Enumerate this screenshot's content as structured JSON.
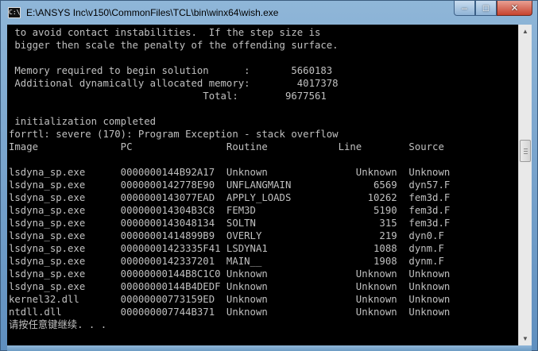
{
  "window": {
    "title": "E:\\ANSYS Inc\\v150\\CommonFiles\\TCL\\bin\\winx64\\wish.exe",
    "icon_text": "C:\\",
    "buttons": {
      "minimize": "–",
      "maximize": "□",
      "close": "✕"
    }
  },
  "console": {
    "lines": [
      " to avoid contact instabilities.  If the step size is",
      " bigger then scale the penalty of the offending surface.",
      "",
      " Memory required to begin solution      :       5660183",
      " Additional dynamically allocated memory:        4017378",
      "                                 Total:        9677561",
      "",
      " initialization completed",
      "forrtl: severe (170): Program Exception - stack overflow",
      "Image              PC                Routine            Line        Source",
      "",
      "lsdyna_sp.exe      0000000144B92A17  Unknown               Unknown  Unknown",
      "lsdyna_sp.exe      0000000142778E90  UNFLANGMAIN              6569  dyn57.F",
      "lsdyna_sp.exe      0000000143077EAD  APPLY_LOADS             10262  fem3d.F",
      "lsdyna_sp.exe      000000014304B3C8  FEM3D                    5190  fem3d.F",
      "lsdyna_sp.exe      0000000143048134  SOLTN                     315  fem3d.F",
      "lsdyna_sp.exe      00000001414899B9  OVERLY                    219  dyn0.F",
      "lsdyna_sp.exe      00000001423335F41 LSDYNA1                  1088  dynm.F",
      "lsdyna_sp.exe      0000000142337201  MAIN__                   1908  dynm.F",
      "lsdyna_sp.exe      00000000144B8C1C0 Unknown               Unknown  Unknown",
      "lsdyna_sp.exe      00000000144B4DEDF Unknown               Unknown  Unknown",
      "kernel32.dll       00000000773159ED  Unknown               Unknown  Unknown",
      "ntdll.dll          000000007744B371  Unknown               Unknown  Unknown",
      "请按任意键继续. . ."
    ]
  }
}
